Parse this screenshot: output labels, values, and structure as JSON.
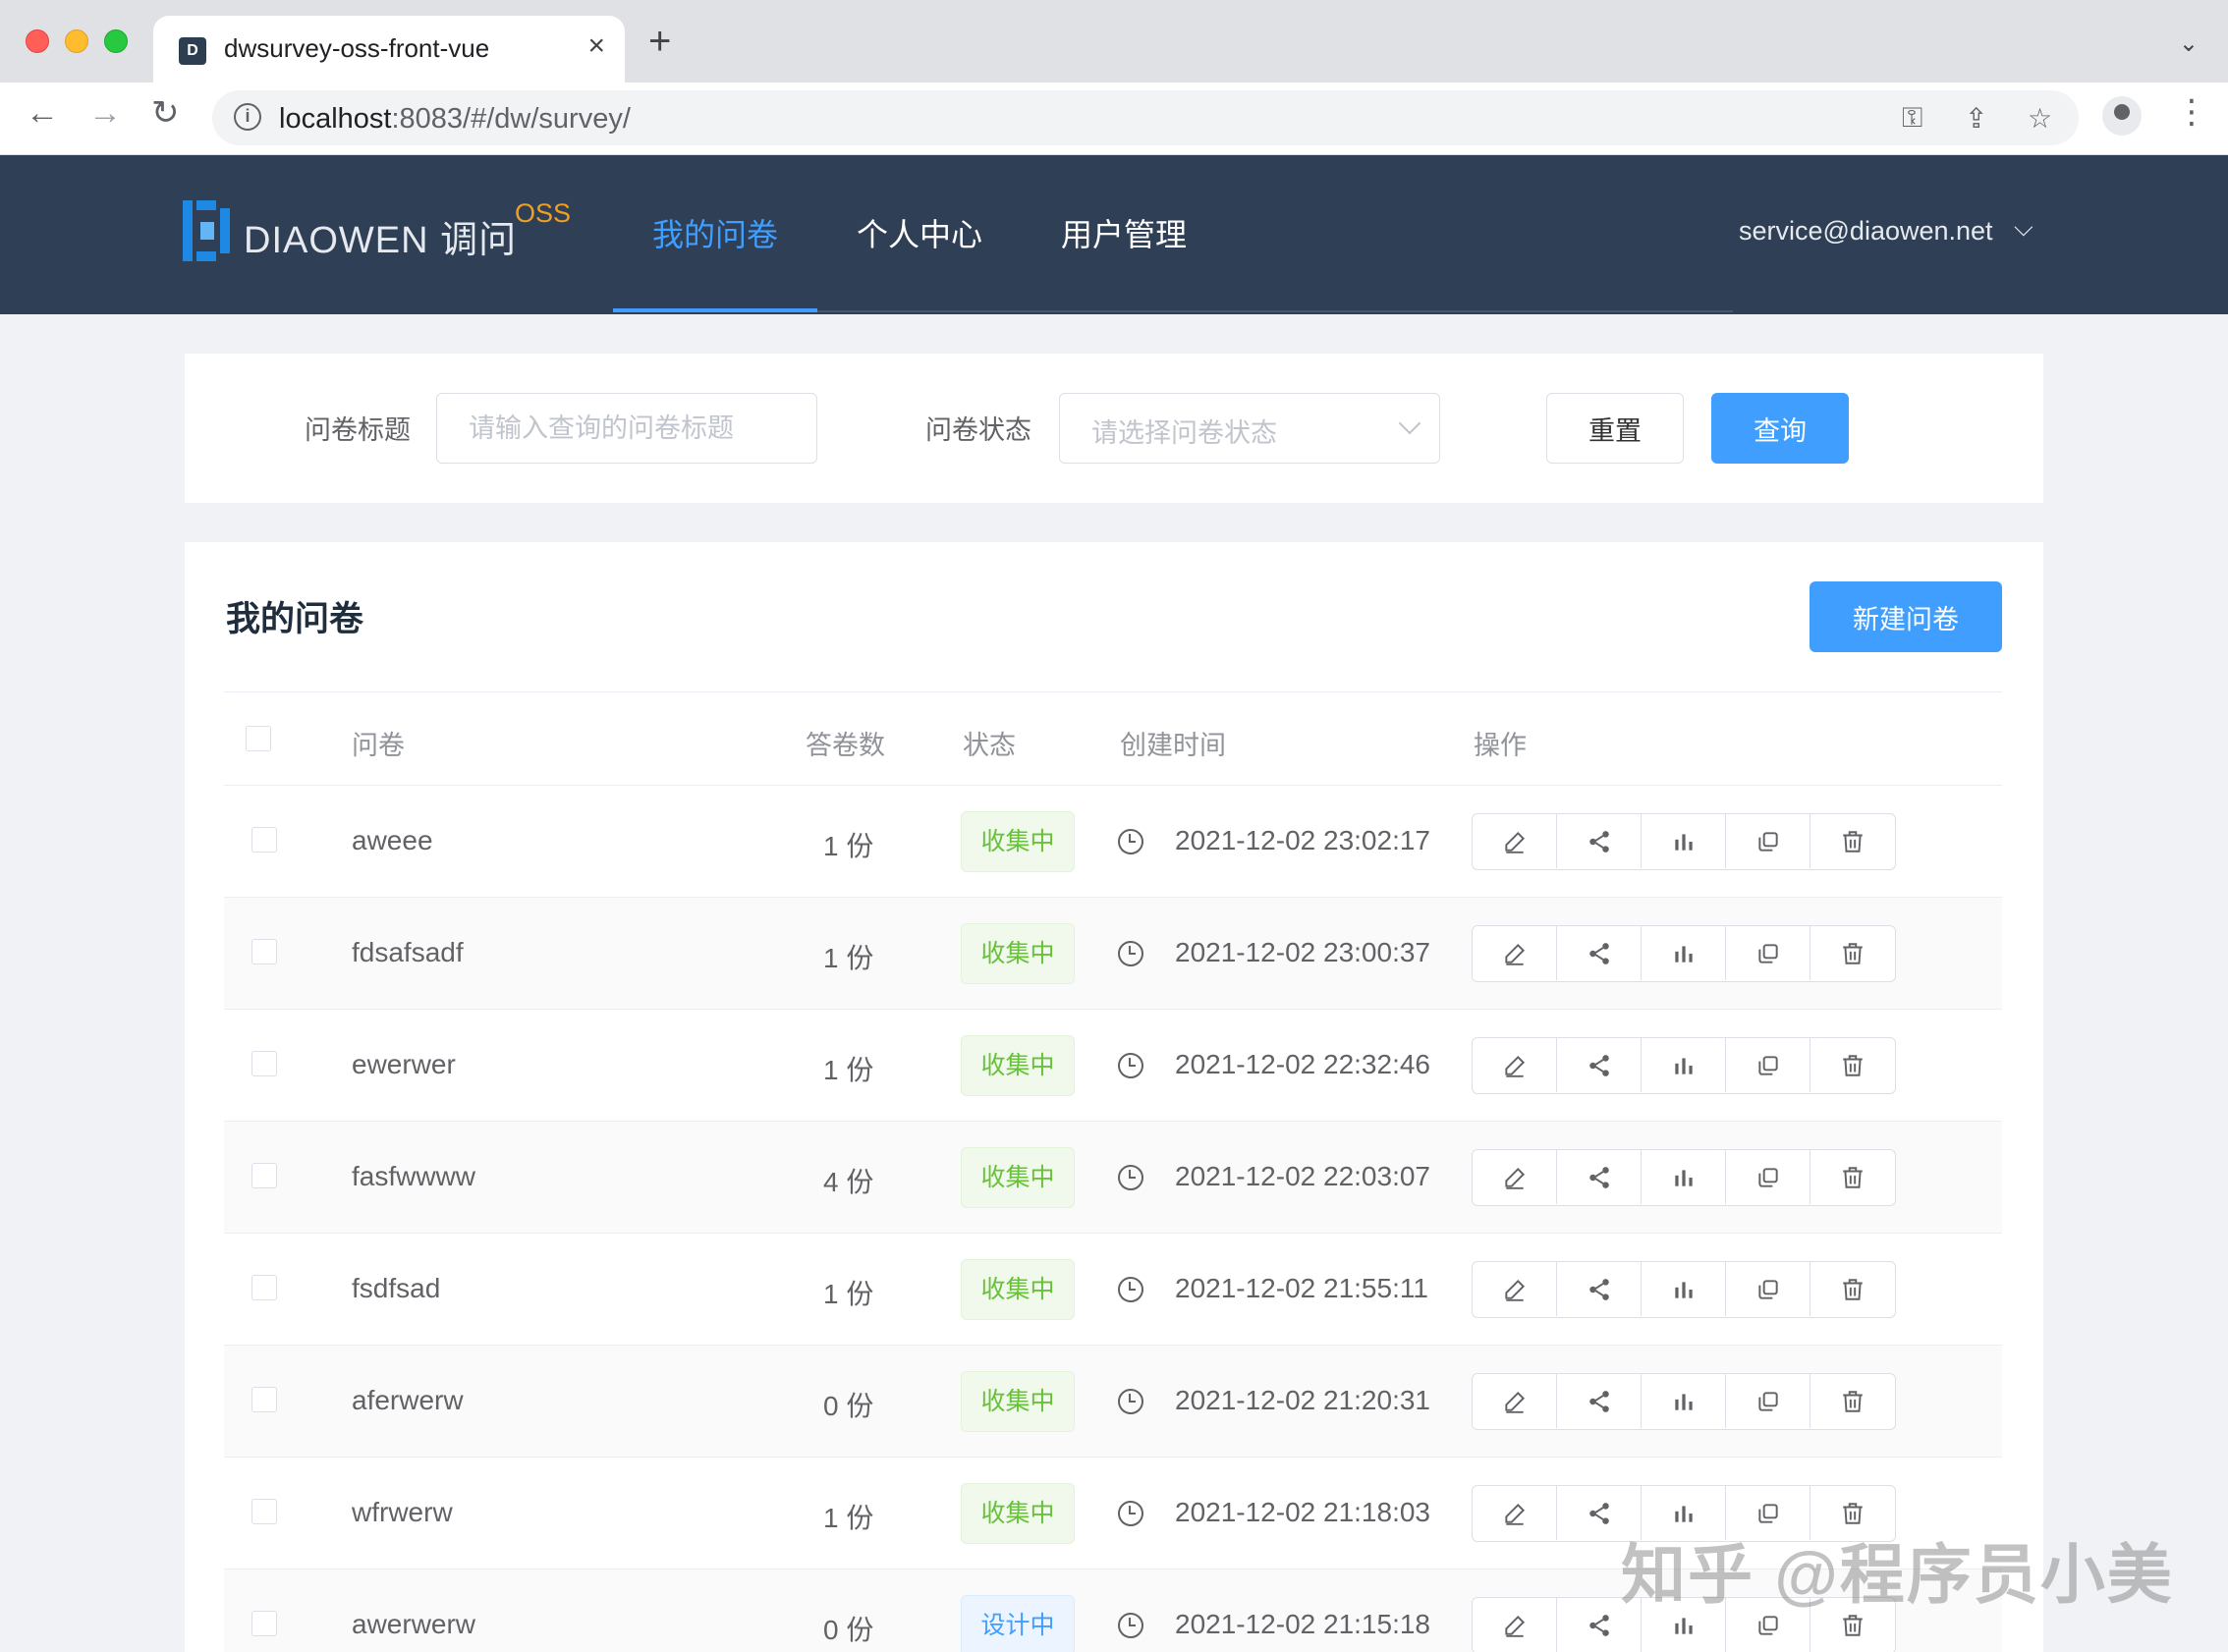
{
  "browser": {
    "tab_title": "dwsurvey-oss-front-vue",
    "tab_favicon": "D",
    "url_host": "localhost",
    "url_rest": ":8083/#/dw/survey/"
  },
  "header": {
    "logo_text": "DIAOWEN 调问",
    "logo_badge": "OSS",
    "nav": [
      "我的问卷",
      "个人中心",
      "用户管理"
    ],
    "active_nav": "我的问卷",
    "user_email": "service@diaowen.net"
  },
  "search": {
    "title_label": "问卷标题",
    "title_placeholder": "请输入查询的问卷标题",
    "status_label": "问卷状态",
    "status_placeholder": "请选择问卷状态",
    "reset_label": "重置",
    "query_label": "查询"
  },
  "list": {
    "title": "我的问卷",
    "new_button": "新建问卷",
    "columns": {
      "name": "问卷",
      "count": "答卷数",
      "status": "状态",
      "created": "创建时间",
      "actions": "操作"
    },
    "rows": [
      {
        "name": "aweee",
        "count": "1 份",
        "status": "收集中",
        "status_color": "#67c23a",
        "created": "2021-12-02 23:02:17"
      },
      {
        "name": "fdsafsadf",
        "count": "1 份",
        "status": "收集中",
        "status_color": "#67c23a",
        "created": "2021-12-02 23:00:37"
      },
      {
        "name": "ewerwer",
        "count": "1 份",
        "status": "收集中",
        "status_color": "#67c23a",
        "created": "2021-12-02 22:32:46"
      },
      {
        "name": "fasfwwww",
        "count": "4 份",
        "status": "收集中",
        "status_color": "#67c23a",
        "created": "2021-12-02 22:03:07"
      },
      {
        "name": "fsdfsad",
        "count": "1 份",
        "status": "收集中",
        "status_color": "#67c23a",
        "created": "2021-12-02 21:55:11"
      },
      {
        "name": "aferwerw",
        "count": "0 份",
        "status": "收集中",
        "status_color": "#67c23a",
        "created": "2021-12-02 21:20:31"
      },
      {
        "name": "wfrwerw",
        "count": "1 份",
        "status": "收集中",
        "status_color": "#67c23a",
        "created": "2021-12-02 21:18:03"
      },
      {
        "name": "awerwerw",
        "count": "0 份",
        "status": "设计中",
        "status_color": "#409eff",
        "created": "2021-12-02 21:15:18"
      }
    ],
    "row_actions": [
      "edit-icon",
      "share-icon",
      "stats-icon",
      "copy-icon",
      "delete-icon"
    ]
  },
  "watermark": "知乎 @程序员小美",
  "colors": {
    "header_bg": "#2f3f56",
    "primary": "#409eff",
    "success": "#67c23a",
    "logo_badge": "#f0a020"
  }
}
